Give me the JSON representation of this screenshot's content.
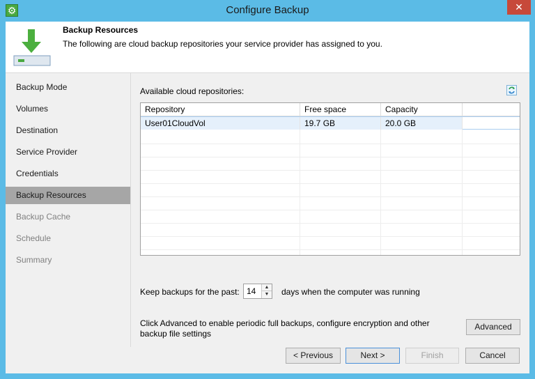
{
  "window": {
    "title": "Configure Backup",
    "close_glyph": "✕",
    "app_icon": "gear-icon"
  },
  "header": {
    "title": "Backup Resources",
    "description": "The following are cloud backup repositories your service provider has assigned to you."
  },
  "nav": {
    "items": [
      {
        "label": "Backup Mode",
        "state": "normal"
      },
      {
        "label": "Volumes",
        "state": "normal"
      },
      {
        "label": "Destination",
        "state": "normal"
      },
      {
        "label": "Service Provider",
        "state": "normal"
      },
      {
        "label": "Credentials",
        "state": "normal"
      },
      {
        "label": "Backup Resources",
        "state": "active"
      },
      {
        "label": "Backup Cache",
        "state": "disabled"
      },
      {
        "label": "Schedule",
        "state": "disabled"
      },
      {
        "label": "Summary",
        "state": "disabled"
      }
    ]
  },
  "repositories": {
    "label": "Available cloud repositories:",
    "columns": [
      "Repository",
      "Free space",
      "Capacity"
    ],
    "rows": [
      {
        "repository": "User01CloudVol",
        "free_space": "19.7 GB",
        "capacity": "20.0 GB",
        "selected": true
      }
    ]
  },
  "retention": {
    "label_before": "Keep backups for the past:",
    "value": "14",
    "label_after": "days when the computer was running"
  },
  "advanced": {
    "description": "Click Advanced to enable periodic full backups, configure encryption and other backup file settings",
    "button_label": "Advanced"
  },
  "footer": {
    "previous_label": "< Previous",
    "next_label": "Next >",
    "finish_label": "Finish",
    "cancel_label": "Cancel"
  },
  "colors": {
    "title_bar": "#5bbbe6",
    "accent_green": "#49a941",
    "selection": "#e5f0fb"
  }
}
